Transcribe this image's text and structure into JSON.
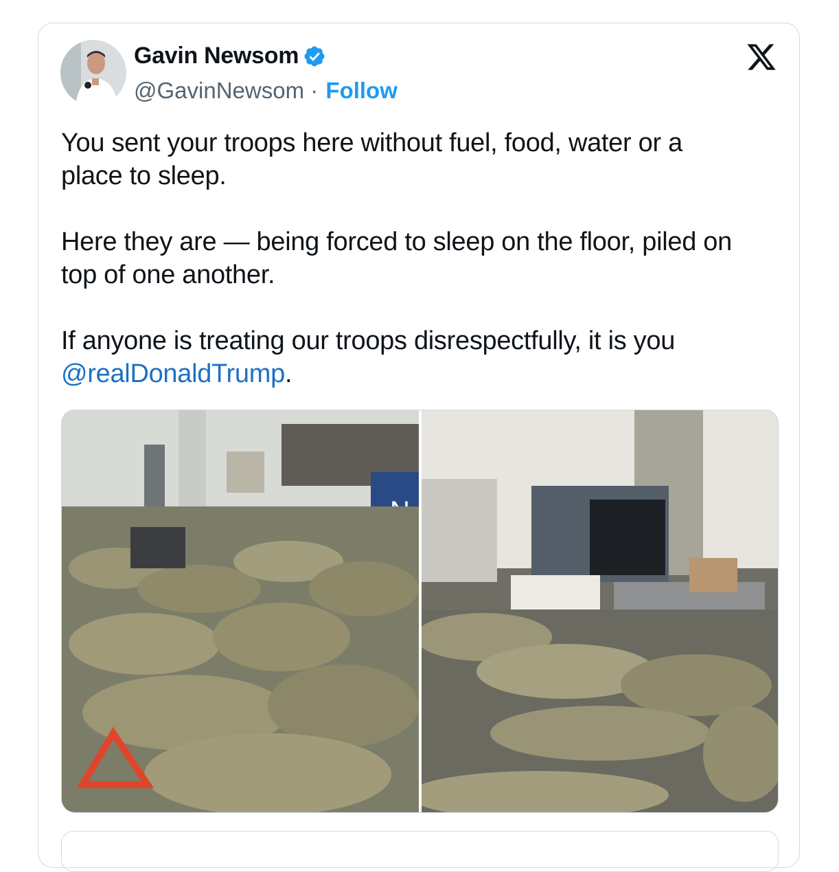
{
  "author": {
    "name": "Gavin Newsom",
    "handle": "@GavinNewsom",
    "separator": " · ",
    "follow_label": "Follow"
  },
  "tweet": {
    "paragraph1": "You sent your troops here without fuel, food, water or a\nplace to sleep.",
    "paragraph2": "Here they are — being forced to sleep on the floor, piled on\ntop of one another.",
    "paragraph3_text": "If anyone is treating our troops disrespectfully, it is you\n",
    "mention": "@realDonaldTrump",
    "paragraph3_end": "."
  },
  "media": {
    "photos": [
      {
        "name": "photo-troops-hallway",
        "sign_letter": "N"
      },
      {
        "name": "photo-troops-checkpoint"
      }
    ]
  },
  "icons": {
    "verified": "verified-badge-icon",
    "platform": "x-logo-icon"
  },
  "colors": {
    "accent": "#1d9bf0",
    "mention": "#1d70c4",
    "secondary_text": "#536471",
    "border": "#cfd9de"
  }
}
